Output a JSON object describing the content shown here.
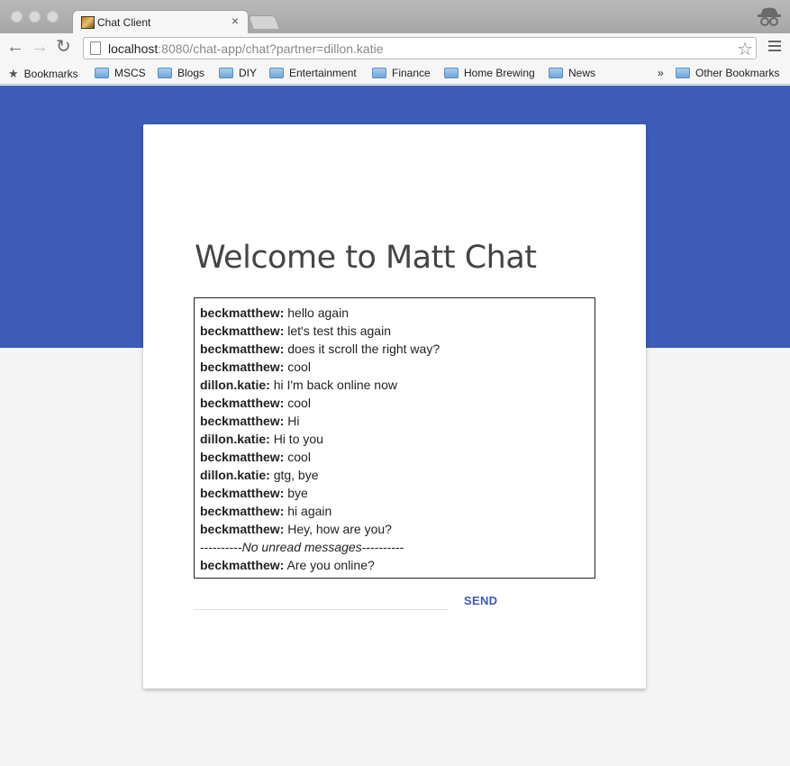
{
  "browser": {
    "tab_title": "Chat Client",
    "tab_close": "×",
    "url_host": "localhost",
    "url_rest": ":8080/chat-app/chat?partner=dillon.katie",
    "bookmarks": [
      "Bookmarks",
      "MSCS",
      "Blogs",
      "DIY",
      "Entertainment",
      "Finance",
      "Home Brewing",
      "News"
    ],
    "overflow": "»",
    "other_bookmarks": "Other Bookmarks"
  },
  "page": {
    "title": "Welcome to Matt Chat",
    "accent_color": "#3d5cb8"
  },
  "chat": {
    "messages": [
      {
        "sender": "beckmatthew:",
        "text": "hello again"
      },
      {
        "sender": "beckmatthew:",
        "text": "let's test this again"
      },
      {
        "sender": "beckmatthew:",
        "text": "does it scroll the right way?"
      },
      {
        "sender": "beckmatthew:",
        "text": "cool"
      },
      {
        "sender": "dillon.katie:",
        "text": "hi I'm back online now"
      },
      {
        "sender": "beckmatthew:",
        "text": "cool"
      },
      {
        "sender": "beckmatthew:",
        "text": "Hi"
      },
      {
        "sender": "dillon.katie:",
        "text": "Hi to you"
      },
      {
        "sender": "beckmatthew:",
        "text": "cool"
      },
      {
        "sender": "dillon.katie:",
        "text": "gtg, bye"
      },
      {
        "sender": "beckmatthew:",
        "text": "bye"
      },
      {
        "sender": "beckmatthew:",
        "text": "hi again"
      },
      {
        "sender": "beckmatthew:",
        "text": "Hey, how are you?"
      }
    ],
    "divider": {
      "left": "----------",
      "text": "No unread messages",
      "right": "----------"
    },
    "last_message": {
      "sender": "beckmatthew:",
      "text": "Are you online?"
    },
    "input_value": "",
    "send_label": "SEND"
  }
}
